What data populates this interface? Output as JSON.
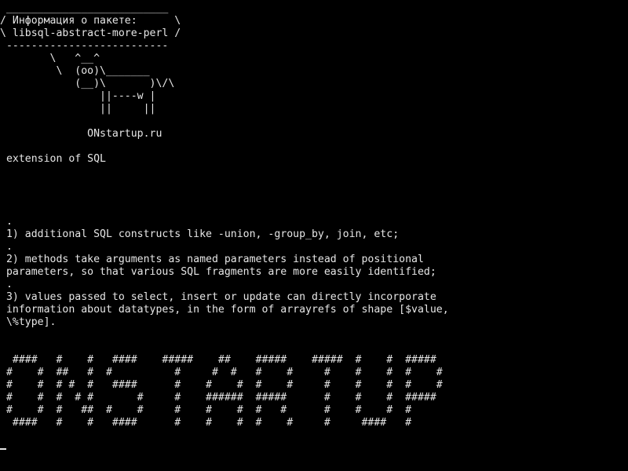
{
  "terminal": {
    "background": "#000000",
    "foreground": "#e6e6e6",
    "banner": {
      "top_border": " __________________________",
      "title_line": "/ Информация о пакете:      \\",
      "package_line": "\\ libsql-abstract-more-perl /",
      "bottom_border": " --------------------------"
    },
    "cow": [
      "        \\   ^__^",
      "         \\  (oo)\\_______",
      "            (__)\\       )\\/\\",
      "                ||----w |",
      "                ||     ||"
    ],
    "site": "              ONstartup.ru",
    "summary": " extension of SQL",
    "description": [
      " .",
      " 1) additional SQL constructs like -union, -group_by, join, etc;",
      " .",
      " 2) methods take arguments as named parameters instead of positional",
      " parameters, so that various SQL fragments are more easily identified;",
      " .",
      " 3) values passed to select, insert or update can directly incorporate",
      " information about datatypes, in the form of arrayrefs of shape [$value,",
      " \\%type]."
    ],
    "ascii_art": [
      "  ####   #    #   ####    #####    ##    #####    #####  #    #  #####",
      " #    #  ##   #  #          #     #  #   #    #     #    #    #  #    #",
      " #    #  # #  #   ####      #    #    #  #    #     #    #    #  #    #",
      " #    #  #  # #       #     #    ######  #####      #    #    #  #####",
      " #    #  #   ##  #    #     #    #    #  #   #      #    #    #  #",
      "  ####   #    #   ####      #    #    #  #    #     #     ####   #"
    ]
  }
}
